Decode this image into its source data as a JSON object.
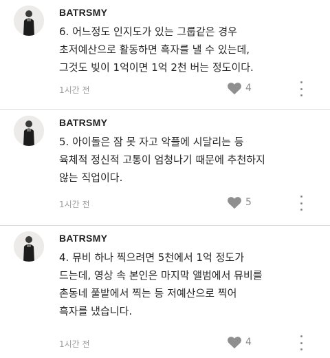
{
  "posts": [
    {
      "username": "BATRSMY",
      "lines": [
        "6. 어느정도 인지도가 있는 그룹같은 경우",
        "초저예산으로 활동하면 흑자를 낼 수 있는데,",
        "그것도 빚이 1억이면 1억 2천 버는 정도이다."
      ],
      "time": "1시간 전",
      "likes": "4"
    },
    {
      "username": "BATRSMY",
      "lines": [
        "5. 아이돌은 잠 못 자고 악플에 시달리는 등",
        "육체적 정신적 고통이 엄청나기 때문에 추천하지",
        "않는 직업이다."
      ],
      "time": "1시간 전",
      "likes": "5"
    },
    {
      "username": "BATRSMY",
      "lines": [
        "4. 뮤비 하나 찍으려면 5천에서 1억 정도가",
        "드는데, 영상  속 본인은 마지막 앨범에서 뮤비를",
        "촌동네 풀밭에서 찍는 등 저예산으로 찍어",
        "흑자를 냈습니다."
      ],
      "time": "1시간 전",
      "likes": "4"
    }
  ],
  "icons": {
    "like": "heart-icon",
    "more": "more-vertical-icon",
    "avatar": "profile-photo"
  },
  "colors": {
    "heart": "#8f8f8f",
    "meta_text": "#9a9a9a",
    "divider": "#d9d9d9"
  }
}
